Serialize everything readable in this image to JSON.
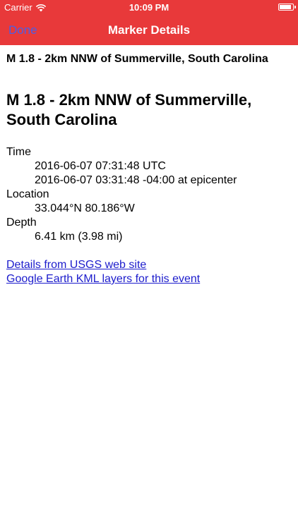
{
  "status_bar": {
    "carrier": "Carrier",
    "time": "10:09 PM"
  },
  "nav": {
    "done_label": "Done",
    "title": "Marker Details"
  },
  "event": {
    "small_title": "M 1.8 - 2km NNW of Summerville, South Carolina",
    "big_title": "M 1.8 - 2km NNW of Summerville, South Carolina",
    "time_label": "Time",
    "time_utc": "2016-06-07 07:31:48 UTC",
    "time_local": "2016-06-07 03:31:48 -04:00 at epicenter",
    "location_label": "Location",
    "location_value": "33.044°N 80.186°W",
    "depth_label": "Depth",
    "depth_value": "6.41 km (3.98 mi)"
  },
  "links": {
    "usgs": "Details from USGS web site",
    "kml": "Google Earth KML layers for this event"
  },
  "colors": {
    "header_bg": "#e8393a",
    "done_button": "#4b5ee6",
    "link": "#1c1ccc"
  }
}
